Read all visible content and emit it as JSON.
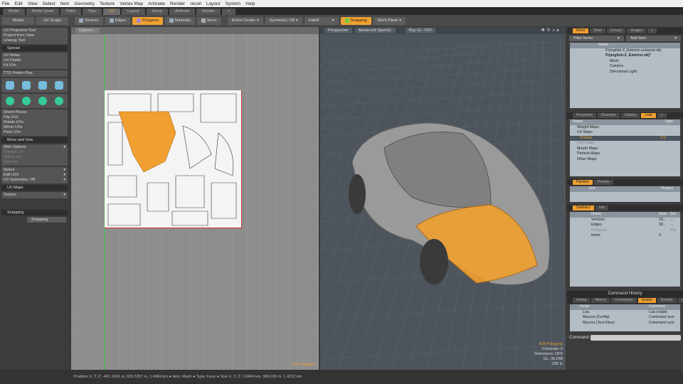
{
  "menu": [
    "File",
    "Edit",
    "View",
    "Select",
    "Item",
    "Geometry",
    "Texture",
    "Vertex Map",
    "Animate",
    "Render",
    "recoil",
    "Layout",
    "System",
    "Help"
  ],
  "layout_tabs": [
    {
      "label": "Model"
    },
    {
      "label": "Model Quad"
    },
    {
      "label": "Paint"
    },
    {
      "label": "Topo"
    },
    {
      "label": "UV",
      "active": true
    },
    {
      "label": "Layout"
    },
    {
      "label": "Setup"
    },
    {
      "label": "Animate"
    },
    {
      "label": "Render"
    },
    {
      "label": "+"
    }
  ],
  "toolbar": {
    "model": "Model",
    "uv_sculpt": "UV Sculpt",
    "vertices": "Vertices",
    "edges": "Edges",
    "polygons": "Polygons",
    "materials": "Materials",
    "items": "Items",
    "action_center": "Action Center",
    "symmetry": "Symmetry: Off",
    "falloff": "Falloff",
    "snapping": "Snapping",
    "work_plane": "Work Plane"
  },
  "left": {
    "tools1": [
      "UV Projection Tool",
      "Project from View",
      "Unwrap Tool"
    ],
    "spread": "Spread",
    "tools2": [
      "UV Relax",
      "UV Peeler",
      "Fit UVs"
    ],
    "ttg": "TTG Peeler Plus",
    "tools3": [
      "Orient Pieces",
      "Flip UVs",
      "Rotate UVs",
      "Mirror UVs",
      "Pack UVs"
    ],
    "move_sew": "Move and Sew",
    "with_options": "With Options",
    "disabled": [
      "Unweld UV",
      "Stamp UV",
      "Sew UV"
    ],
    "select": "Select",
    "edit_uvs": "Edit UVs",
    "uv_symmetry": "UV Symmetry: Off",
    "uv_maps": "UV Maps",
    "texture": "Texture",
    "snapping_hdr": "Snapping",
    "snapping_btn": "Snapping"
  },
  "uv_view": {
    "options": "Options...",
    "poly_count": "428 Polygons"
  },
  "view3d": {
    "perspective": "Perspective",
    "opengl": "Advanced OpenGL",
    "raygl": "Ray GL: OFF",
    "info": [
      "428 Polygons",
      "Channels: 0",
      "Deformers: OFF",
      "GL: 30,248",
      "200 in"
    ]
  },
  "items_panel": {
    "tabs": [
      "Items",
      "Shad",
      "Groups",
      "Images",
      "+"
    ],
    "filter": "Filter Items",
    "add_item": "Add Item",
    "col_name": "Name",
    "rows": [
      "Flyingfish-2_Exterior-uvlayout.obj",
      "Flyingfish-2_Exterior.obj*",
      "Mesh",
      "Camera",
      "Directional Light"
    ]
  },
  "lists_panel": {
    "tabs": [
      "Properties",
      "Channels",
      "Display",
      "Lists",
      "+"
    ],
    "col_name": "Name",
    "col_type": "Type",
    "rows": [
      {
        "name": "Weight Maps"
      },
      {
        "name": "UV Maps"
      },
      {
        "name": "Texture",
        "type": "UV",
        "sel": true
      },
      {
        "name": "(new map)"
      },
      {
        "name": "Morph Maps"
      },
      {
        "name": "Particle Maps"
      },
      {
        "name": "Other Maps"
      }
    ]
  },
  "pipeline": {
    "tabs": [
      "Pipeline",
      "Presets"
    ],
    "col_tool": "Tool",
    "col_project": "Project"
  },
  "statistics": {
    "tabs": [
      "Statistics",
      "Info"
    ],
    "col_name": "Name",
    "col_num": "Num",
    "col_sel": "Sel",
    "rows": [
      {
        "name": "Vertices",
        "num": "16...",
        "sel": "..."
      },
      {
        "name": "Edges",
        "num": "32...",
        "sel": "..."
      },
      {
        "name": "Polygons",
        "num": "...",
        "sel": "428"
      },
      {
        "name": "Items",
        "num": "0",
        "sel": ""
      }
    ]
  },
  "command_history": {
    "title": "Command History",
    "tabs": [
      "Undos",
      "History",
      "Commands",
      "Scripts",
      "Results",
      "+"
    ],
    "col_script": "Script",
    "col_comment": "Comment",
    "rows": [
      {
        "script": "Lua",
        "comment": "Lua scripts"
      },
      {
        "script": "Macros (Config)",
        "comment": "Command syst"
      },
      {
        "script": "Macros (Text Files)",
        "comment": "Command syst"
      }
    ],
    "command_label": "Command"
  },
  "status": "Position X, Y, Z:  -401.2481 m, 836.5357 m, 1.4684 km  ● Item: Mesh ● Type: Face ● Size X, Y, Z:  1.8464 km, 380.039 m, 1.4222 km",
  "colors": {
    "accent": "#f0a030",
    "viewport": "#4d545c",
    "uv_bg": "#8d8d8d"
  }
}
